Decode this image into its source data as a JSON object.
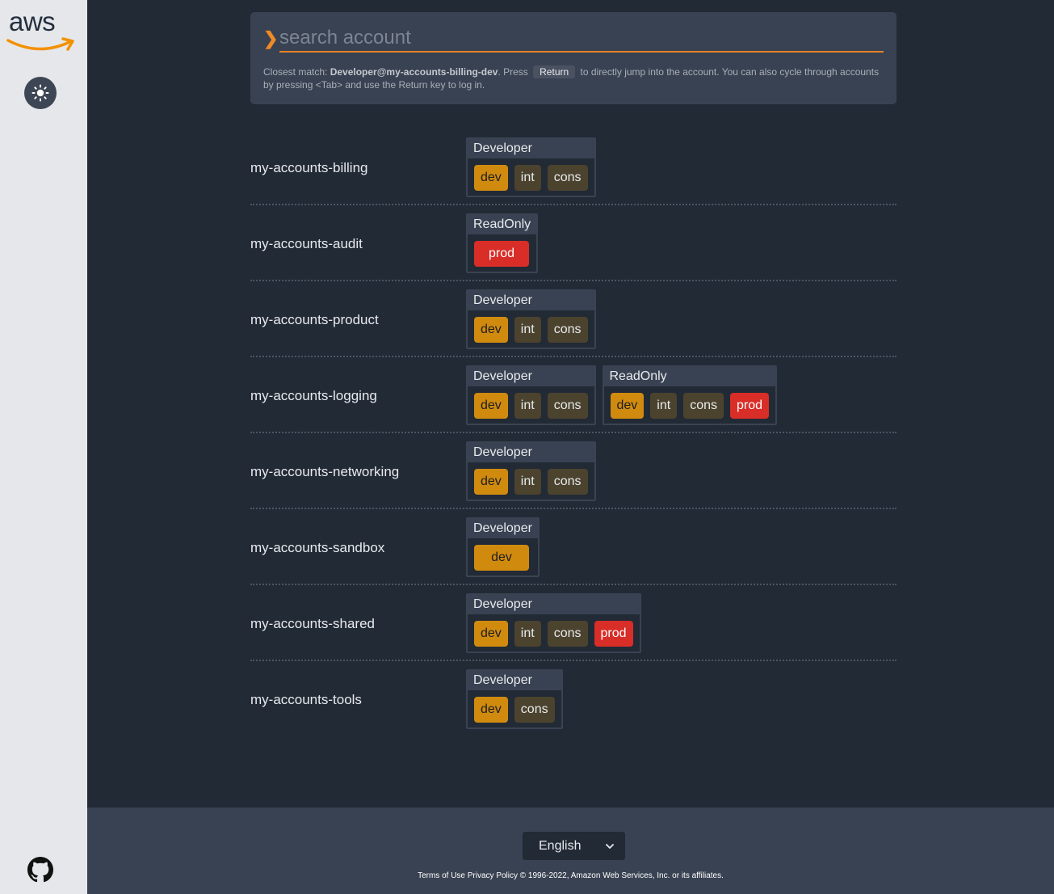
{
  "search": {
    "placeholder": "search account",
    "hint_prefix": "Closest match: ",
    "closest_match": "Developer@my-accounts-billing-dev",
    "hint_mid": ". Press ",
    "key": "Return",
    "hint_suffix": " to directly jump into the account. You can also cycle through accounts by pressing <Tab> and use the Return key to log in."
  },
  "accounts": [
    {
      "name": "my-accounts-billing",
      "roles": [
        {
          "title": "Developer",
          "envs": [
            "dev",
            "int",
            "cons"
          ]
        }
      ]
    },
    {
      "name": "my-accounts-audit",
      "roles": [
        {
          "title": "ReadOnly",
          "envs": [
            "prod"
          ]
        }
      ]
    },
    {
      "name": "my-accounts-product",
      "roles": [
        {
          "title": "Developer",
          "envs": [
            "dev",
            "int",
            "cons"
          ]
        }
      ]
    },
    {
      "name": "my-accounts-logging",
      "roles": [
        {
          "title": "Developer",
          "envs": [
            "dev",
            "int",
            "cons"
          ]
        },
        {
          "title": "ReadOnly",
          "envs": [
            "dev",
            "int",
            "cons",
            "prod"
          ]
        }
      ]
    },
    {
      "name": "my-accounts-networking",
      "roles": [
        {
          "title": "Developer",
          "envs": [
            "dev",
            "int",
            "cons"
          ]
        }
      ]
    },
    {
      "name": "my-accounts-sandbox",
      "roles": [
        {
          "title": "Developer",
          "envs": [
            "dev"
          ]
        }
      ]
    },
    {
      "name": "my-accounts-shared",
      "roles": [
        {
          "title": "Developer",
          "envs": [
            "dev",
            "int",
            "cons",
            "prod"
          ]
        }
      ]
    },
    {
      "name": "my-accounts-tools",
      "roles": [
        {
          "title": "Developer",
          "envs": [
            "dev",
            "cons"
          ]
        }
      ]
    }
  ],
  "footer": {
    "language": "English",
    "links_text": "Terms of Use Privacy Policy © 1996-2022, Amazon Web Services, Inc. or its affiliates."
  },
  "sidebar": {
    "logo_text": "aws",
    "icons": [
      "aws-logo",
      "theme-toggle-icon",
      "github-icon"
    ]
  },
  "colors": {
    "dev": "#d08b0f",
    "int": "#4b432e",
    "cons": "#4b432e",
    "prod": "#d92d27",
    "accent": "#f08a24"
  }
}
